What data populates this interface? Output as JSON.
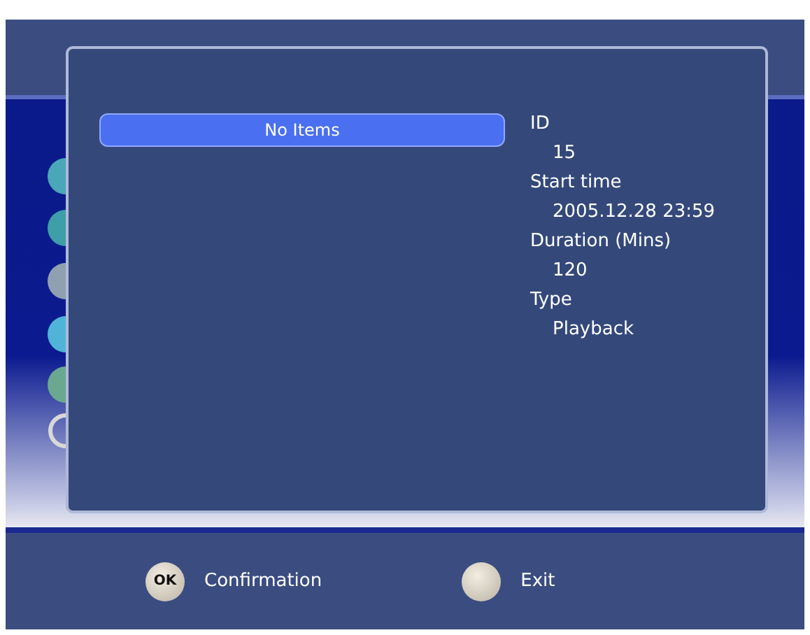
{
  "list": {
    "items": [
      {
        "label": "No Items",
        "selected": true
      }
    ]
  },
  "details": [
    {
      "label": "ID",
      "value": "15"
    },
    {
      "label": "Start time",
      "value": "2005.12.28 23:59"
    },
    {
      "label": "Duration (Mins)",
      "value": "120"
    },
    {
      "label": "Type",
      "value": "Playback"
    }
  ],
  "footer": [
    {
      "kind": "ok",
      "key": "OK",
      "label": "Confirmation"
    },
    {
      "kind": "blank",
      "label": "Exit"
    }
  ]
}
